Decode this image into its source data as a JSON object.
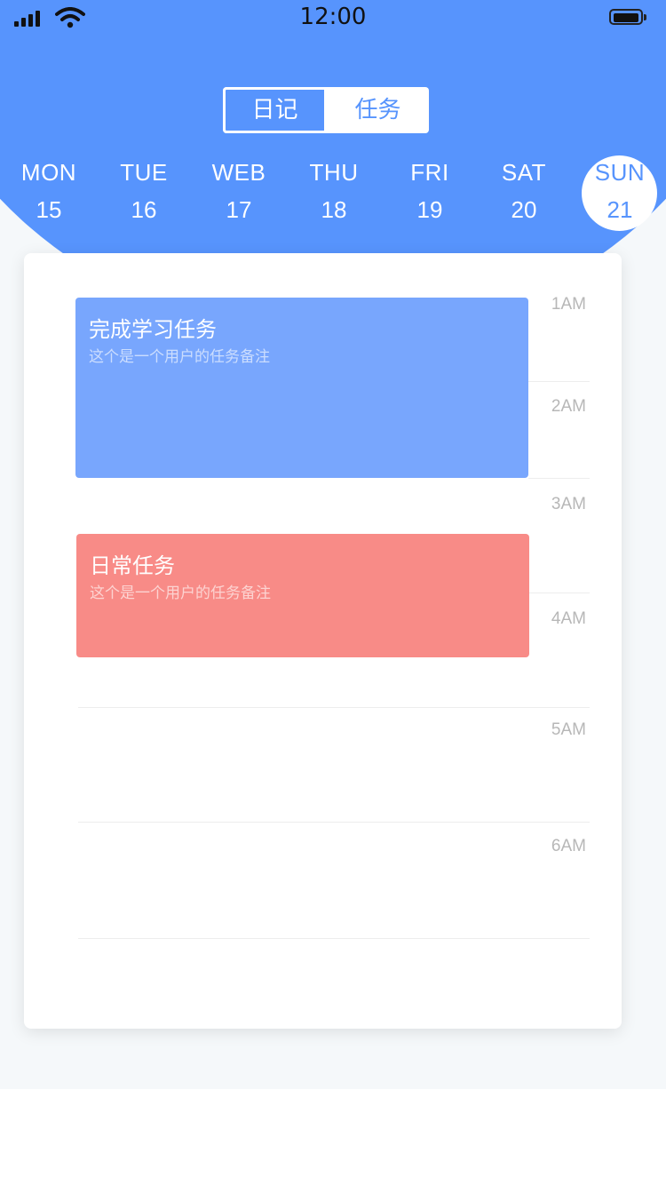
{
  "status_bar": {
    "time": "12:00"
  },
  "segmented": {
    "diary": "日记",
    "tasks": "任务",
    "active": "diary"
  },
  "week": {
    "days": [
      {
        "name": "MON",
        "date": "15"
      },
      {
        "name": "TUE",
        "date": "16"
      },
      {
        "name": "WEB",
        "date": "17"
      },
      {
        "name": "THU",
        "date": "18"
      },
      {
        "name": "FRI",
        "date": "19"
      },
      {
        "name": "SAT",
        "date": "20"
      },
      {
        "name": "SUN",
        "date": "21"
      }
    ],
    "selected": "SUN"
  },
  "timeline": {
    "hours": [
      "1AM",
      "2AM",
      "3AM",
      "4AM",
      "5AM",
      "6AM"
    ],
    "tasks": [
      {
        "title": "完成学习任务",
        "note": "这个是一个用户的任务备注",
        "color": "#78a6fd"
      },
      {
        "title": "日常任务",
        "note": "这个是一个用户的任务备注",
        "color": "#f88b87"
      }
    ]
  },
  "colors": {
    "accent": "#5794fd",
    "background": "#f5f8fa"
  }
}
